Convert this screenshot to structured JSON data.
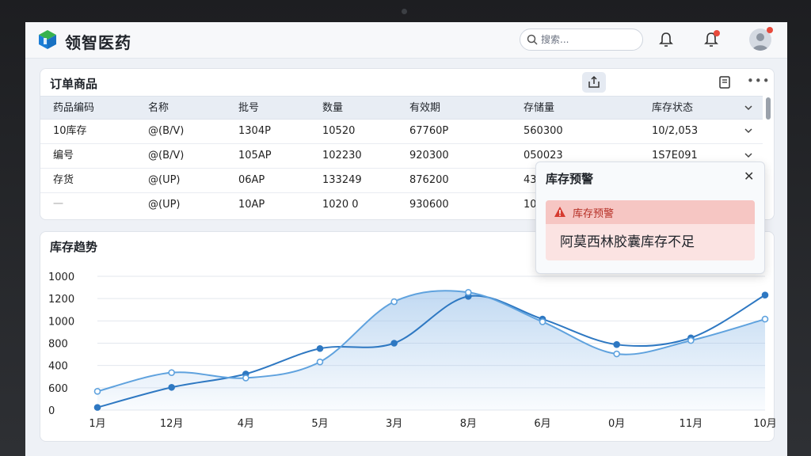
{
  "app": {
    "brand": "领智医药",
    "search_placeholder": "搜索..."
  },
  "orders": {
    "title": "订单商品",
    "columns": [
      "药品编码",
      "名称",
      "批号",
      "数量",
      "有效期",
      "存储量",
      "库存状态"
    ],
    "rows": [
      [
        "10库存",
        "@(B/V)",
        "1304P",
        "10520",
        "67760P",
        "560300",
        "10/2,053"
      ],
      [
        "编号",
        "@(B/V)",
        "105AP",
        "102230",
        "920300",
        "050023",
        "1S7E091"
      ],
      [
        "存货",
        "@(UP)",
        "06AP",
        "133249",
        "876200",
        "43",
        ""
      ],
      [
        "一",
        "@(UP)",
        "10AP",
        "1020 0",
        "930600",
        "10",
        ""
      ]
    ]
  },
  "alert": {
    "title": "库存预警",
    "label": "库存预警",
    "message": "阿莫西林胶囊库存不足"
  },
  "trend": {
    "title": "库存趋势"
  },
  "chart_data": {
    "type": "line",
    "title": "库存趋势",
    "categories": [
      "1月",
      "12月",
      "4月",
      "5月",
      "3月",
      "8月",
      "6月",
      "0月",
      "11月",
      "10月"
    ],
    "yticks": [
      "0",
      "600",
      "400",
      "800",
      "1000",
      "1200",
      "1000"
    ],
    "series": [
      {
        "values": [
          20,
          170,
          270,
          460,
          500,
          850,
          680,
          490,
          540,
          860
        ]
      },
      {
        "values": [
          140,
          280,
          240,
          360,
          810,
          880,
          660,
          420,
          520,
          680
        ]
      }
    ],
    "ylim": [
      0,
      1000
    ],
    "colors": [
      "#2e78c2",
      "#5fa2de"
    ],
    "grid": true
  }
}
